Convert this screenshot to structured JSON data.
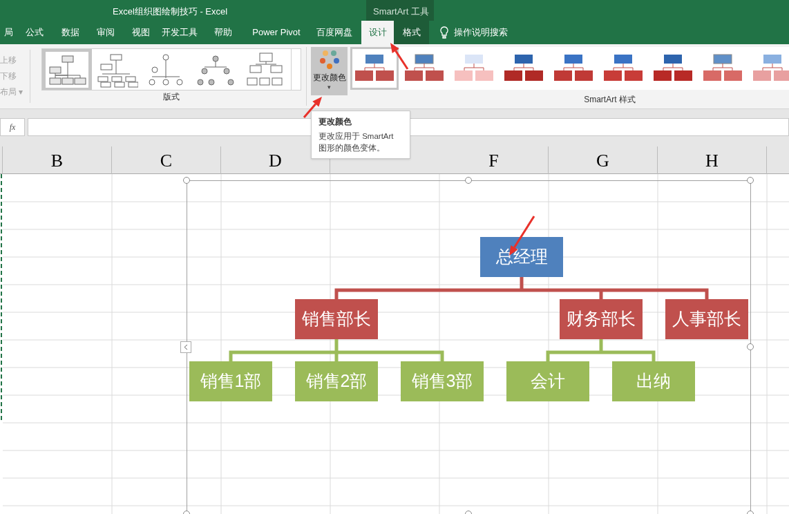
{
  "window": {
    "title": "Excel组织图绘制技巧  -  Excel",
    "contextual_title": "SmartArt 工具"
  },
  "tabs": [
    {
      "label": "局",
      "selected": false
    },
    {
      "label": "公式",
      "selected": false
    },
    {
      "label": "数据",
      "selected": false
    },
    {
      "label": "审阅",
      "selected": false
    },
    {
      "label": "视图",
      "selected": false
    },
    {
      "label": "开发工具",
      "selected": false
    },
    {
      "label": "帮助",
      "selected": false
    },
    {
      "label": "Power Pivot",
      "selected": false
    },
    {
      "label": "百度网盘",
      "selected": false
    },
    {
      "label": "设计",
      "selected": true
    },
    {
      "label": "格式",
      "selected": false
    }
  ],
  "tell_me": {
    "label": "操作说明搜索"
  },
  "ribbon": {
    "left_commands": [
      {
        "label": "上移",
        "disabled": true
      },
      {
        "label": "下移",
        "disabled": true
      },
      {
        "label": "布局 ▾",
        "disabled": true
      }
    ],
    "layouts": {
      "label": "版式",
      "items": [
        {
          "selected": true
        },
        {
          "selected": false
        },
        {
          "selected": false
        },
        {
          "selected": false
        },
        {
          "selected": false
        }
      ]
    },
    "change_color": {
      "label": "更改颜色",
      "caret": "▾"
    },
    "styles": {
      "label": "SmartArt 样式",
      "items": [
        {
          "selected": true
        },
        {
          "selected": false
        },
        {
          "selected": false
        },
        {
          "selected": false
        },
        {
          "selected": false
        },
        {
          "selected": false
        },
        {
          "selected": false
        },
        {
          "selected": false
        },
        {
          "selected": false
        }
      ]
    }
  },
  "tooltip": {
    "title": "更改颜色",
    "body": "更改应用于 SmartArt 图形的颜色变体。"
  },
  "formula_bar": {
    "fx": "fx"
  },
  "columns": [
    "B",
    "C",
    "D",
    "F",
    "G",
    "H"
  ],
  "org_chart": {
    "text": "总经理",
    "children": [
      {
        "text": "销售部长",
        "children": [
          {
            "text": "销售1部"
          },
          {
            "text": "销售2部"
          },
          {
            "text": "销售3部"
          }
        ]
      },
      {
        "text": "财务部长",
        "children": [
          {
            "text": "会计"
          },
          {
            "text": "出纳"
          }
        ]
      },
      {
        "text": "人事部长"
      }
    ]
  }
}
